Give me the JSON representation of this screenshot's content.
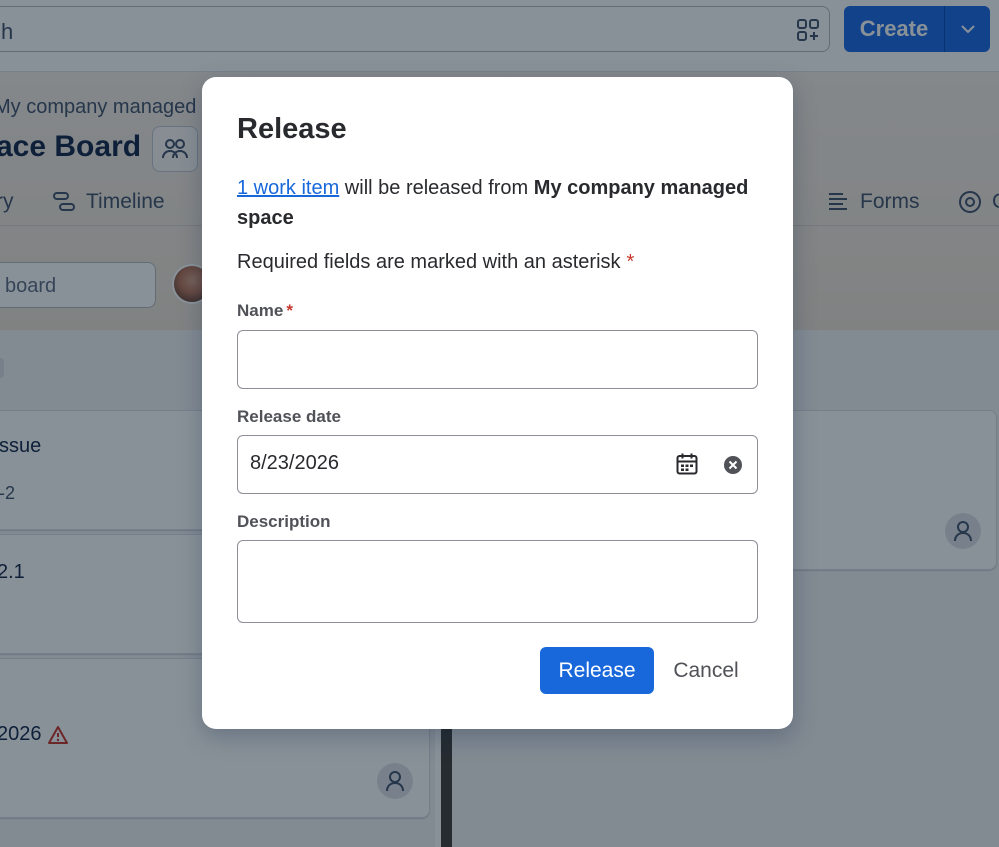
{
  "topbar": {
    "search_text": "h",
    "create_label": "Create"
  },
  "space": {
    "breadcrumb": "My company managed",
    "board_title": "ace Board",
    "nav": [
      {
        "label": "ry"
      },
      {
        "label": "Timeline"
      },
      {
        "label": "Forms"
      },
      {
        "label": "C"
      }
    ],
    "board_search_placeholder": "board"
  },
  "board": {
    "cards": [
      {
        "title": "ssue",
        "key": "-2"
      },
      {
        "title": "2.1"
      },
      {
        "title": "2026"
      }
    ]
  },
  "modal": {
    "title": "Release",
    "link_text": "1 work item",
    "desc_middle": " will be released from ",
    "desc_bold": "My company managed space",
    "required_note": "Required fields are marked with an asterisk",
    "asterisk": "*",
    "fields": {
      "name_label": "Name",
      "name_value": "",
      "date_label": "Release date",
      "date_value": "8/23/2026",
      "description_label": "Description",
      "description_value": ""
    },
    "buttons": {
      "release": "Release",
      "cancel": "Cancel"
    }
  },
  "colors": {
    "primary": "#1868db",
    "create": "#1d6ae5",
    "required": "#c9372c",
    "warning": "#c9372c"
  },
  "icons": [
    "apps-icon",
    "chevron-down-icon",
    "people-icon",
    "timeline-icon",
    "forms-icon",
    "target-icon",
    "warning-icon",
    "person-icon",
    "calendar-icon",
    "clear-icon"
  ]
}
